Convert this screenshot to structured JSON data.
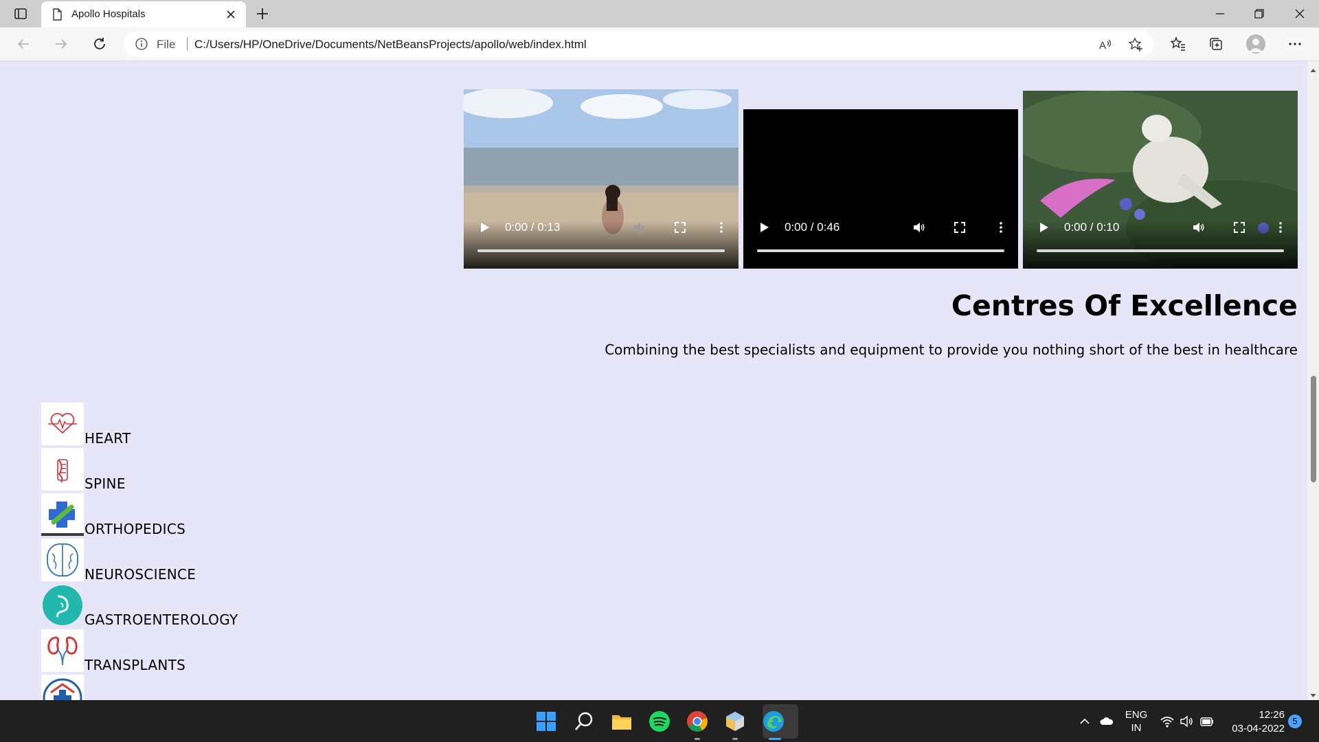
{
  "browser": {
    "tab_title": "Apollo Hospitals",
    "address_scheme": "File",
    "address_url": "C:/Users/HP/OneDrive/Documents/NetBeansProjects/apollo/web/index.html"
  },
  "videos": [
    {
      "time": "0:00 / 0:13",
      "scene": "beach"
    },
    {
      "time": "0:00 / 0:46",
      "scene": "black"
    },
    {
      "time": "0:00 / 0:10",
      "scene": "animation"
    }
  ],
  "section": {
    "title": "Centres Of Excellence",
    "subtitle": "Combining the best specialists and equipment to provide you nothing short of the best in healthcare"
  },
  "centres": [
    {
      "label": "HEART",
      "icon": "heart-icon"
    },
    {
      "label": "SPINE",
      "icon": "spine-icon"
    },
    {
      "label": "ORTHOPEDICS",
      "icon": "orthopedics-icon"
    },
    {
      "label": "NEUROSCIENCE",
      "icon": "brain-icon"
    },
    {
      "label": "GASTROENTEROLOGY",
      "icon": "stomach-icon"
    },
    {
      "label": "TRANSPLANTS",
      "icon": "kidney-icon"
    }
  ],
  "taskbar": {
    "lang_line1": "ENG",
    "lang_line2": "IN",
    "time": "12:26",
    "date": "03-04-2022",
    "notification_count": "5"
  },
  "colors": {
    "page_background": "#e6e6f8",
    "taskbar": "#202020",
    "accent": "#0078d4"
  }
}
